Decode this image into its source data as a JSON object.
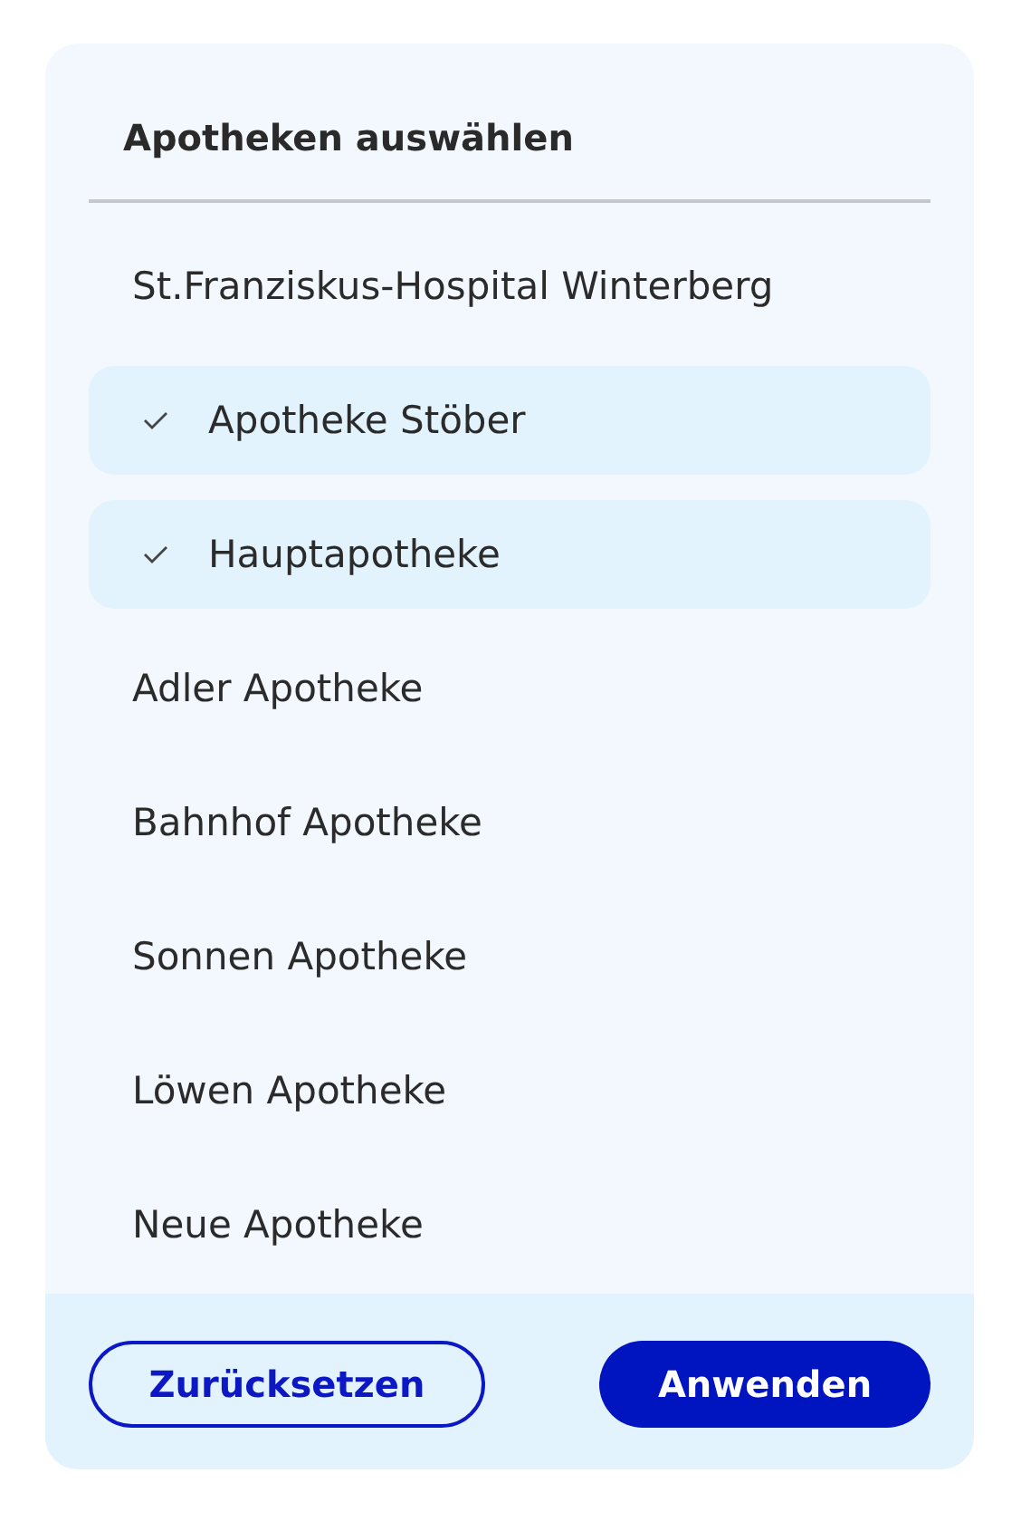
{
  "title": "Apotheken auswählen",
  "options": [
    {
      "label": "St.Franziskus-Hospital Winterberg",
      "selected": false
    },
    {
      "label": "Apotheke Stöber",
      "selected": true
    },
    {
      "label": "Hauptapotheke",
      "selected": true
    },
    {
      "label": "Adler Apotheke",
      "selected": false
    },
    {
      "label": "Bahnhof Apotheke",
      "selected": false
    },
    {
      "label": "Sonnen Apotheke",
      "selected": false
    },
    {
      "label": "Löwen Apotheke",
      "selected": false
    },
    {
      "label": "Neue Apotheke",
      "selected": false
    }
  ],
  "buttons": [
    {
      "label": "Zurücksetzen",
      "kind": "secondary"
    },
    {
      "label": "Anwenden",
      "kind": "primary"
    }
  ]
}
